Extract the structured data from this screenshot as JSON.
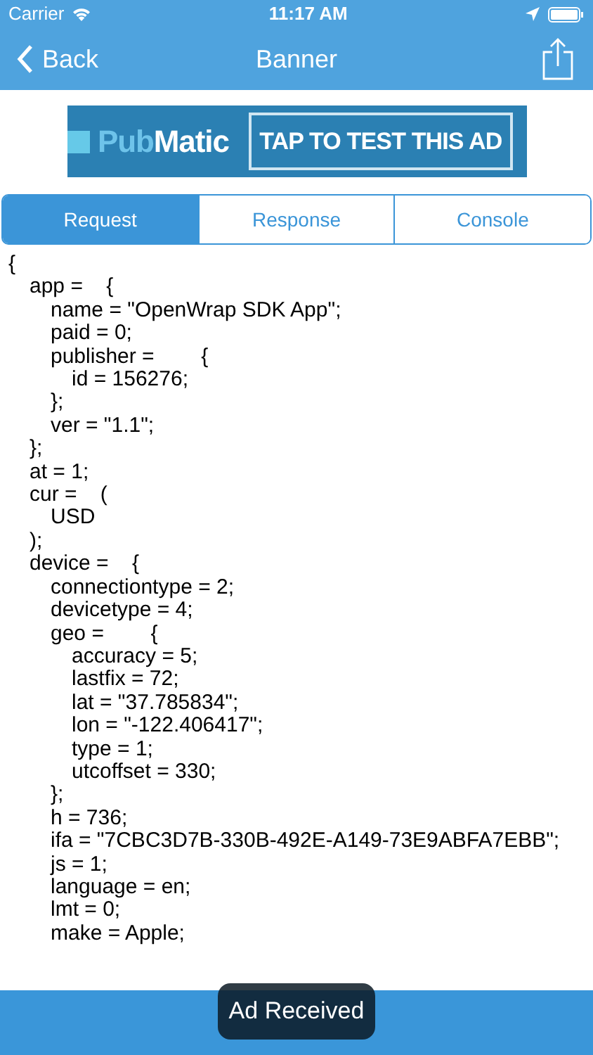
{
  "status_bar": {
    "carrier": "Carrier",
    "time": "11:17 AM"
  },
  "nav": {
    "back": "Back",
    "title": "Banner"
  },
  "banner": {
    "logo_parts": [
      "Pub",
      "Matic"
    ],
    "cta": "TAP TO TEST THIS AD"
  },
  "tabs": [
    {
      "label": "Request",
      "selected": true
    },
    {
      "label": "Response",
      "selected": false
    },
    {
      "label": "Console",
      "selected": false
    }
  ],
  "log": [
    {
      "text": "{",
      "children": [
        {
          "text": "app =    {",
          "children": [
            {
              "text": "name = \"OpenWrap SDK App\";"
            },
            {
              "text": "paid = 0;"
            },
            {
              "text": "publisher =        {",
              "children": [
                {
                  "text": "id = 156276;"
                }
              ]
            },
            {
              "text": "};"
            },
            {
              "text": "ver = \"1.1\";"
            }
          ]
        },
        {
          "text": "};"
        },
        {
          "text": "at = 1;"
        },
        {
          "text": "cur =    (",
          "children": [
            {
              "text": "USD"
            }
          ]
        },
        {
          "text": ");"
        },
        {
          "text": "device =    {",
          "children": [
            {
              "text": "connectiontype = 2;"
            },
            {
              "text": "devicetype = 4;"
            },
            {
              "text": "geo =        {",
              "children": [
                {
                  "text": "accuracy = 5;"
                },
                {
                  "text": "lastfix = 72;"
                },
                {
                  "text": "lat = \"37.785834\";"
                },
                {
                  "text": "lon = \"-122.406417\";"
                },
                {
                  "text": "type = 1;"
                },
                {
                  "text": "utcoffset = 330;"
                }
              ]
            },
            {
              "text": "};"
            },
            {
              "text": "h = 736;"
            },
            {
              "text": "ifa = \"7CBC3D7B-330B-492E-A149-73E9ABFA7EBB\";"
            },
            {
              "text": "js = 1;"
            },
            {
              "text": "language = en;"
            },
            {
              "text": "lmt = 0;"
            },
            {
              "text": "make = Apple;"
            }
          ]
        }
      ]
    }
  ],
  "toast": "Ad Received"
}
